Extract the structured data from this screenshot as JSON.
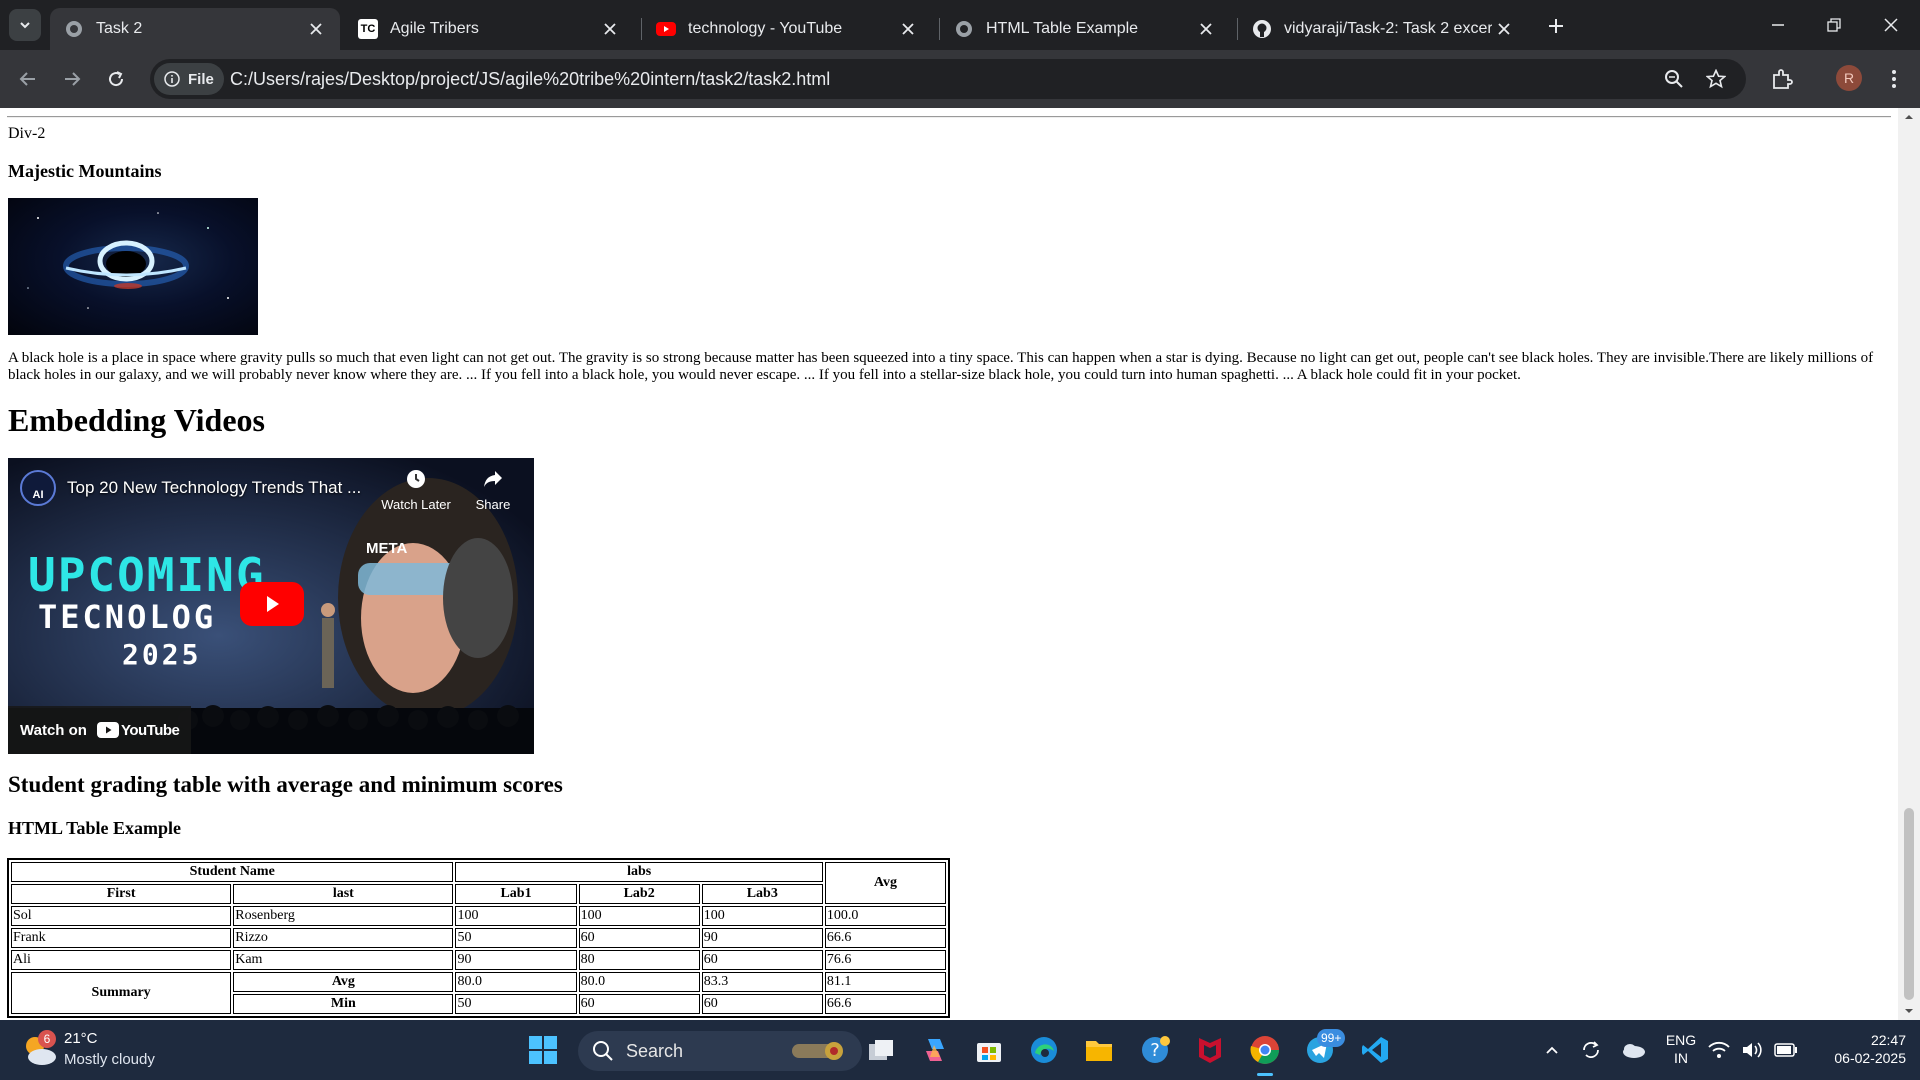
{
  "browser": {
    "tabs": [
      {
        "title": "Task 2",
        "icon": "globe-icon",
        "active": true
      },
      {
        "title": "Agile Tribers",
        "icon": "tc-logo-icon",
        "active": false
      },
      {
        "title": "technology - YouTube",
        "icon": "youtube-icon",
        "active": false
      },
      {
        "title": "HTML Table Example",
        "icon": "globe-icon",
        "active": false
      },
      {
        "title": "vidyaraji/Task-2: Task 2 excercise",
        "icon": "github-icon",
        "active": false
      }
    ],
    "chip_label": "File",
    "url": "C:/Users/rajes/Desktop/project/JS/agile%20tribe%20intern/task2/task2.html",
    "profile_initial": "R"
  },
  "page": {
    "div_label": "Div-2",
    "mountains_heading": "Majestic Mountains",
    "blackhole_text": "A black hole is a place in space where gravity pulls so much that even light can not get out. The gravity is so strong because matter has been squeezed into a tiny space. This can happen when a star is dying. Because no light can get out, people can't see black holes. They are invisible.There are likely millions of black holes in our galaxy, and we will probably never know where they are. ... If you fell into a black hole, you would never escape. ... If you fell into a stellar-size black hole, you could turn into human spaghetti. ... A black hole could fit in your pocket.",
    "embed_heading": "Embedding Videos",
    "video": {
      "channel_badge": "AI",
      "title": "Top 20 New Technology Trends That ...",
      "watch_later": "Watch Later",
      "share": "Share",
      "overlay_line1": "UPCOMING",
      "overlay_line2": "TECNOLOG",
      "overlay_line3": "2025",
      "meta_text": "META",
      "watch_on": "Watch on",
      "youtube": "YouTube"
    },
    "grading_heading": "Student grading table with average and minimum scores",
    "table_heading": "HTML Table Example",
    "table": {
      "group_student": "Student Name",
      "group_labs": "labs",
      "avg_header": "Avg",
      "col_first": "First",
      "col_last": "last",
      "col_lab1": "Lab1",
      "col_lab2": "Lab2",
      "col_lab3": "Lab3",
      "rows": [
        {
          "first": "Sol",
          "last": "Rosenberg",
          "lab1": "100",
          "lab2": "100",
          "lab3": "100",
          "avg": "100.0"
        },
        {
          "first": "Frank",
          "last": "Rizzo",
          "lab1": "50",
          "lab2": "60",
          "lab3": "90",
          "avg": "66.6"
        },
        {
          "first": "Ali",
          "last": "Kam",
          "lab1": "90",
          "lab2": "80",
          "lab3": "60",
          "avg": "76.6"
        }
      ],
      "summary_label": "Summary",
      "summary_avg": {
        "label": "Avg",
        "lab1": "80.0",
        "lab2": "80.0",
        "lab3": "83.3",
        "avg": "81.1"
      },
      "summary_min": {
        "label": "Min",
        "lab1": "50",
        "lab2": "60",
        "lab3": "60",
        "avg": "66.6"
      }
    }
  },
  "taskbar": {
    "weather_badge": "6",
    "temperature": "21°C",
    "weather": "Mostly cloudy",
    "search_label": "Search",
    "badge_count": "99+",
    "lang": "ENG",
    "region": "IN",
    "time": "22:47",
    "date": "06-02-2025"
  },
  "colors": {
    "tab_strip": "#202124",
    "toolbar": "#35363a",
    "taskbar": "#1e2a3e",
    "youtube_red": "#ff0000",
    "accent_cyan": "#2ee6e6"
  }
}
